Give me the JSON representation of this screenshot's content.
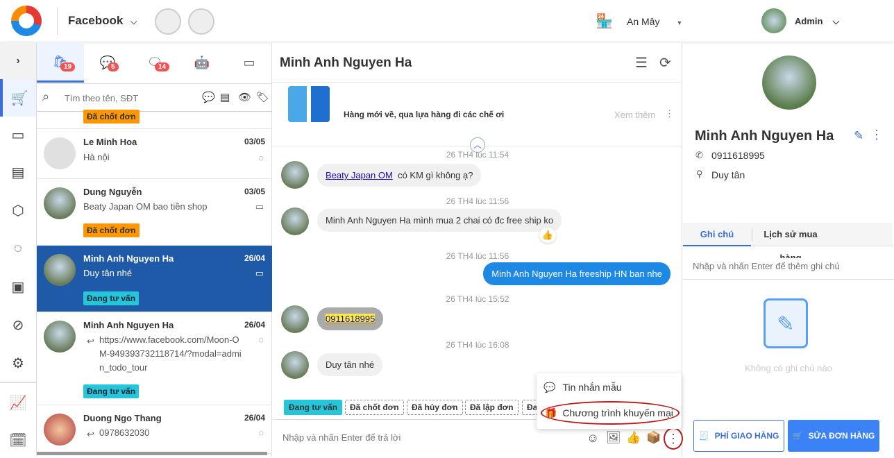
{
  "header": {
    "channel": "Facebook",
    "store": "An Mây",
    "user": "Admin"
  },
  "tabs": [
    {
      "badge": "19"
    },
    {
      "badge": "5"
    },
    {
      "badge": "14"
    }
  ],
  "search": {
    "placeholder": "Tìm theo tên, SĐT"
  },
  "top_tag": "Đã chốt đơn",
  "conversations": [
    {
      "name": "Le Minh Hoa",
      "date": "03/05",
      "message": "Hà nội"
    },
    {
      "name": "Dung Nguyễn",
      "date": "03/05",
      "message": "Beaty Japan OM bao tiền shop",
      "tag": "Đã chốt đơn"
    },
    {
      "name": "Minh Anh Nguyen Ha",
      "date": "26/04",
      "message": "Duy tân nhé",
      "tag": "Đang tư vấn"
    },
    {
      "name": "Minh Anh Nguyen Ha",
      "date": "26/04",
      "message": "https://www.facebook.com/Moon-OM-949393732118714/?modal=admin_todo_tour",
      "tag": "Đang tư vấn"
    },
    {
      "name": "Duong Ngo Thang",
      "date": "26/04",
      "message": "0978632030"
    }
  ],
  "chat": {
    "title": "Minh Anh Nguyen Ha",
    "product_text": "Hàng mới về, qua lựa hàng đi các chế ơi",
    "see_more": "Xem thêm",
    "messages": [
      {
        "time": "26 TH4 lúc 11:54",
        "link": "Beaty Japan OM",
        "text": "có KM gì không ạ?"
      },
      {
        "time": "26 TH4 lúc 11:56",
        "text": "Minh Anh Nguyen Ha mình mua 2 chai có đc free ship ko"
      },
      {
        "time": "26 TH4 lúc 11:56",
        "text": "Minh Anh Nguyen Ha freeship HN ban nhe"
      },
      {
        "time": "26 TH4 lúc 15:52",
        "text": "0911618995"
      },
      {
        "time": "26 TH4 lúc 16:08",
        "text": "Duy tân nhé"
      }
    ],
    "tags": [
      "Đang tư vấn",
      "Đã chốt đơn",
      "Đã hủy đơn",
      "Đã lập đơn",
      "Đa"
    ],
    "input_placeholder": "Nhập và nhấn Enter để trả lời",
    "menu": [
      "Tin nhắn mẫu",
      "Chương trình khuyến mại"
    ]
  },
  "customer": {
    "name": "Minh Anh Nguyen Ha",
    "phone": "0911618995",
    "address": "Duy tân",
    "tabs": [
      "Ghi chú",
      "Lịch sử mua hàng"
    ],
    "note_placeholder": "Nhập và nhấn Enter để thêm ghi chú",
    "empty_note": "Không có ghi chú nào",
    "ship_button": "PHÍ GIAO HÀNG",
    "edit_order_button": "SỬA ĐƠN HÀNG"
  },
  "colors": {
    "primary": "#1e5aa8",
    "accent": "#3b82f6",
    "badge": "#f05454",
    "orange": "#ff9800",
    "cyan": "#26c6da"
  }
}
